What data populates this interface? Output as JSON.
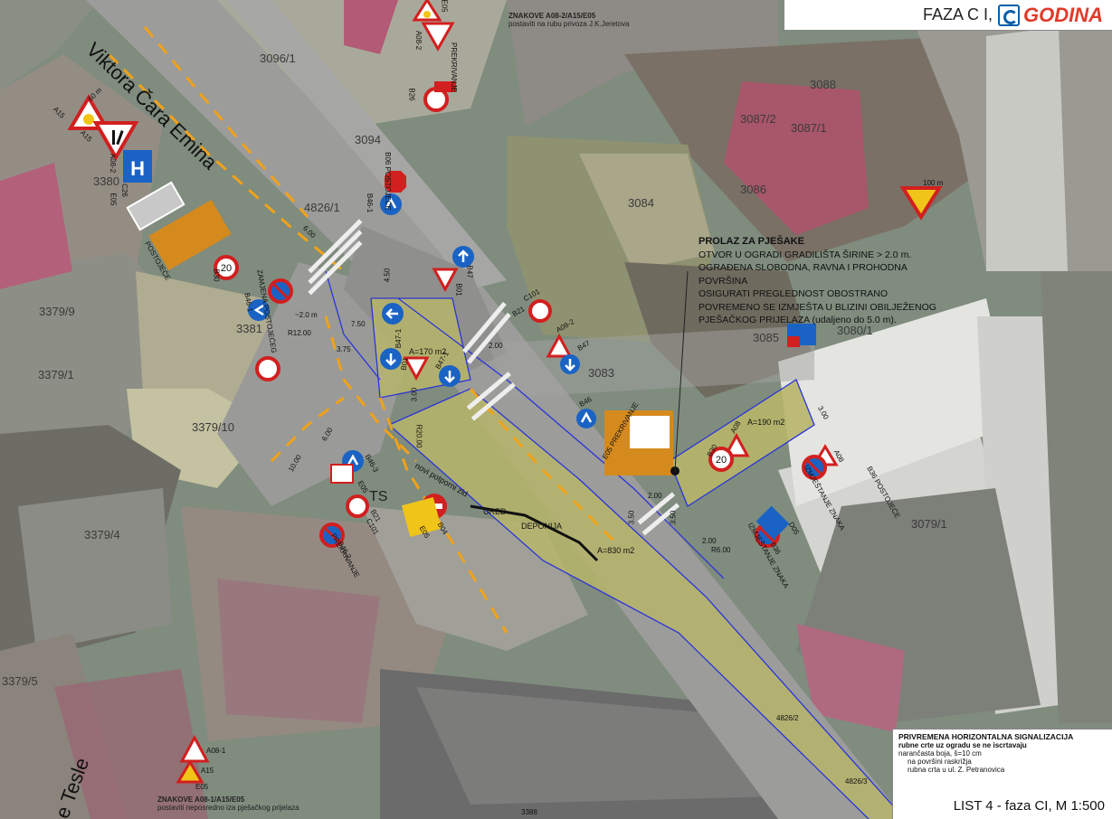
{
  "header": {
    "phase_label": "FAZA C I,",
    "logo_text": "GODINA"
  },
  "street_names": {
    "viktora": "Viktora Čara Emina",
    "tesle": "e Tesle"
  },
  "parcels": [
    "3096/1",
    "3094",
    "4826/1",
    "3088",
    "3087/2",
    "3087/1",
    "3086",
    "3084",
    "3380",
    "3379/9",
    "3379/1",
    "3379/10",
    "3381",
    "3083",
    "3080/1",
    "3079/1",
    "3379/4",
    "3379/5",
    "3388",
    "4826/2",
    "4826/3",
    "3085"
  ],
  "area_labels": [
    "A=170 m2",
    "A=190 m2",
    "A=830 m2"
  ],
  "site_labels": {
    "ts": "TS",
    "wall": "novi potporni zid",
    "office": "URED",
    "depot": "DEPONIJA"
  },
  "pedestrian_note": {
    "title": "PROLAZ ZA PJEŠAKE",
    "lines": [
      "OTVOR U OGRADI GRADILIŠTA ŠIRINE > 2.0 m.",
      "OGRAĐENA SLOBODNA, RAVNA I PROHODNA POVRŠINA",
      "OSIGURATI PREGLEDNOST OBOSTRANO",
      "POVREMENO SE IZMJEŠTA U BLIZINI OBILJEŽENOG",
      "PJEŠAČKOG PRIJELAZA (udaljeno do 5.0 m)."
    ]
  },
  "sign_notes": {
    "top_hdr": "ZNAKOVE A08-2/A15/E05",
    "top_sub": "postaviti na rubu privoza J.K.Jeretova",
    "bottom_hdr": "ZNAKOVE A08-1/A15/E05",
    "bottom_sub": "postaviti neposredno iza pješačkog prijelaza"
  },
  "sign_codes": [
    "A15",
    "E05",
    "A08-2",
    "B26",
    "PREKRIVANJE",
    "B06 POSTOJEĆE",
    "B46-1",
    "A15",
    "A08-2",
    "E05",
    "C26",
    "POSTOJEĆE",
    "B30",
    "ZAMJENA POSTOJEĆEG",
    "B46-1",
    "B47",
    "B01",
    "B47-1",
    "B47-1",
    "B01",
    "B21",
    "C101",
    "A08-2",
    "B47",
    "B46",
    "E05 PREKRIVANJE",
    "A08",
    "B30",
    "A08",
    "B36 POSTOJEĆE",
    "IZMJEŠTANJE ZNAKA",
    "D05",
    "B36",
    "IZMJEŠTANJE ZNAKA",
    "B46-3",
    "E05",
    "B21",
    "C101",
    "B46-2",
    "PREKRIVANJE",
    "B04",
    "E05",
    "A08-1",
    "A15",
    "E05",
    "100 m",
    "60 m"
  ],
  "dimensions": [
    "6.00",
    "4.50",
    "2.00",
    "7.50",
    "3.75",
    "3.00",
    "R20.00",
    "10.00",
    "6.00",
    "3.00",
    "2.00",
    "3.50",
    "2.00",
    "R6.00",
    "3.50",
    "~2.0 m",
    "R12.00"
  ],
  "legend": {
    "title": "PRIVREMENA HORIZONTALNA SIGNALIZACIJA",
    "line1": "rubne crte uz ogradu se ne iscrtavaju",
    "line2": "narančasta boja, š=10 cm",
    "item1": "na površini raskrižja",
    "item2": "rubna crta u ul. Z. Petranovica"
  },
  "sheet_label": "LIST 4 - faza CI, M 1:500",
  "colors": {
    "site_fill": "#b7b56a",
    "road": "#9a9a9a",
    "marking": "#f0a21a",
    "sign_blue": "#1a63c4",
    "sign_red": "#d21f1f",
    "boundary": "#2a35d8"
  }
}
